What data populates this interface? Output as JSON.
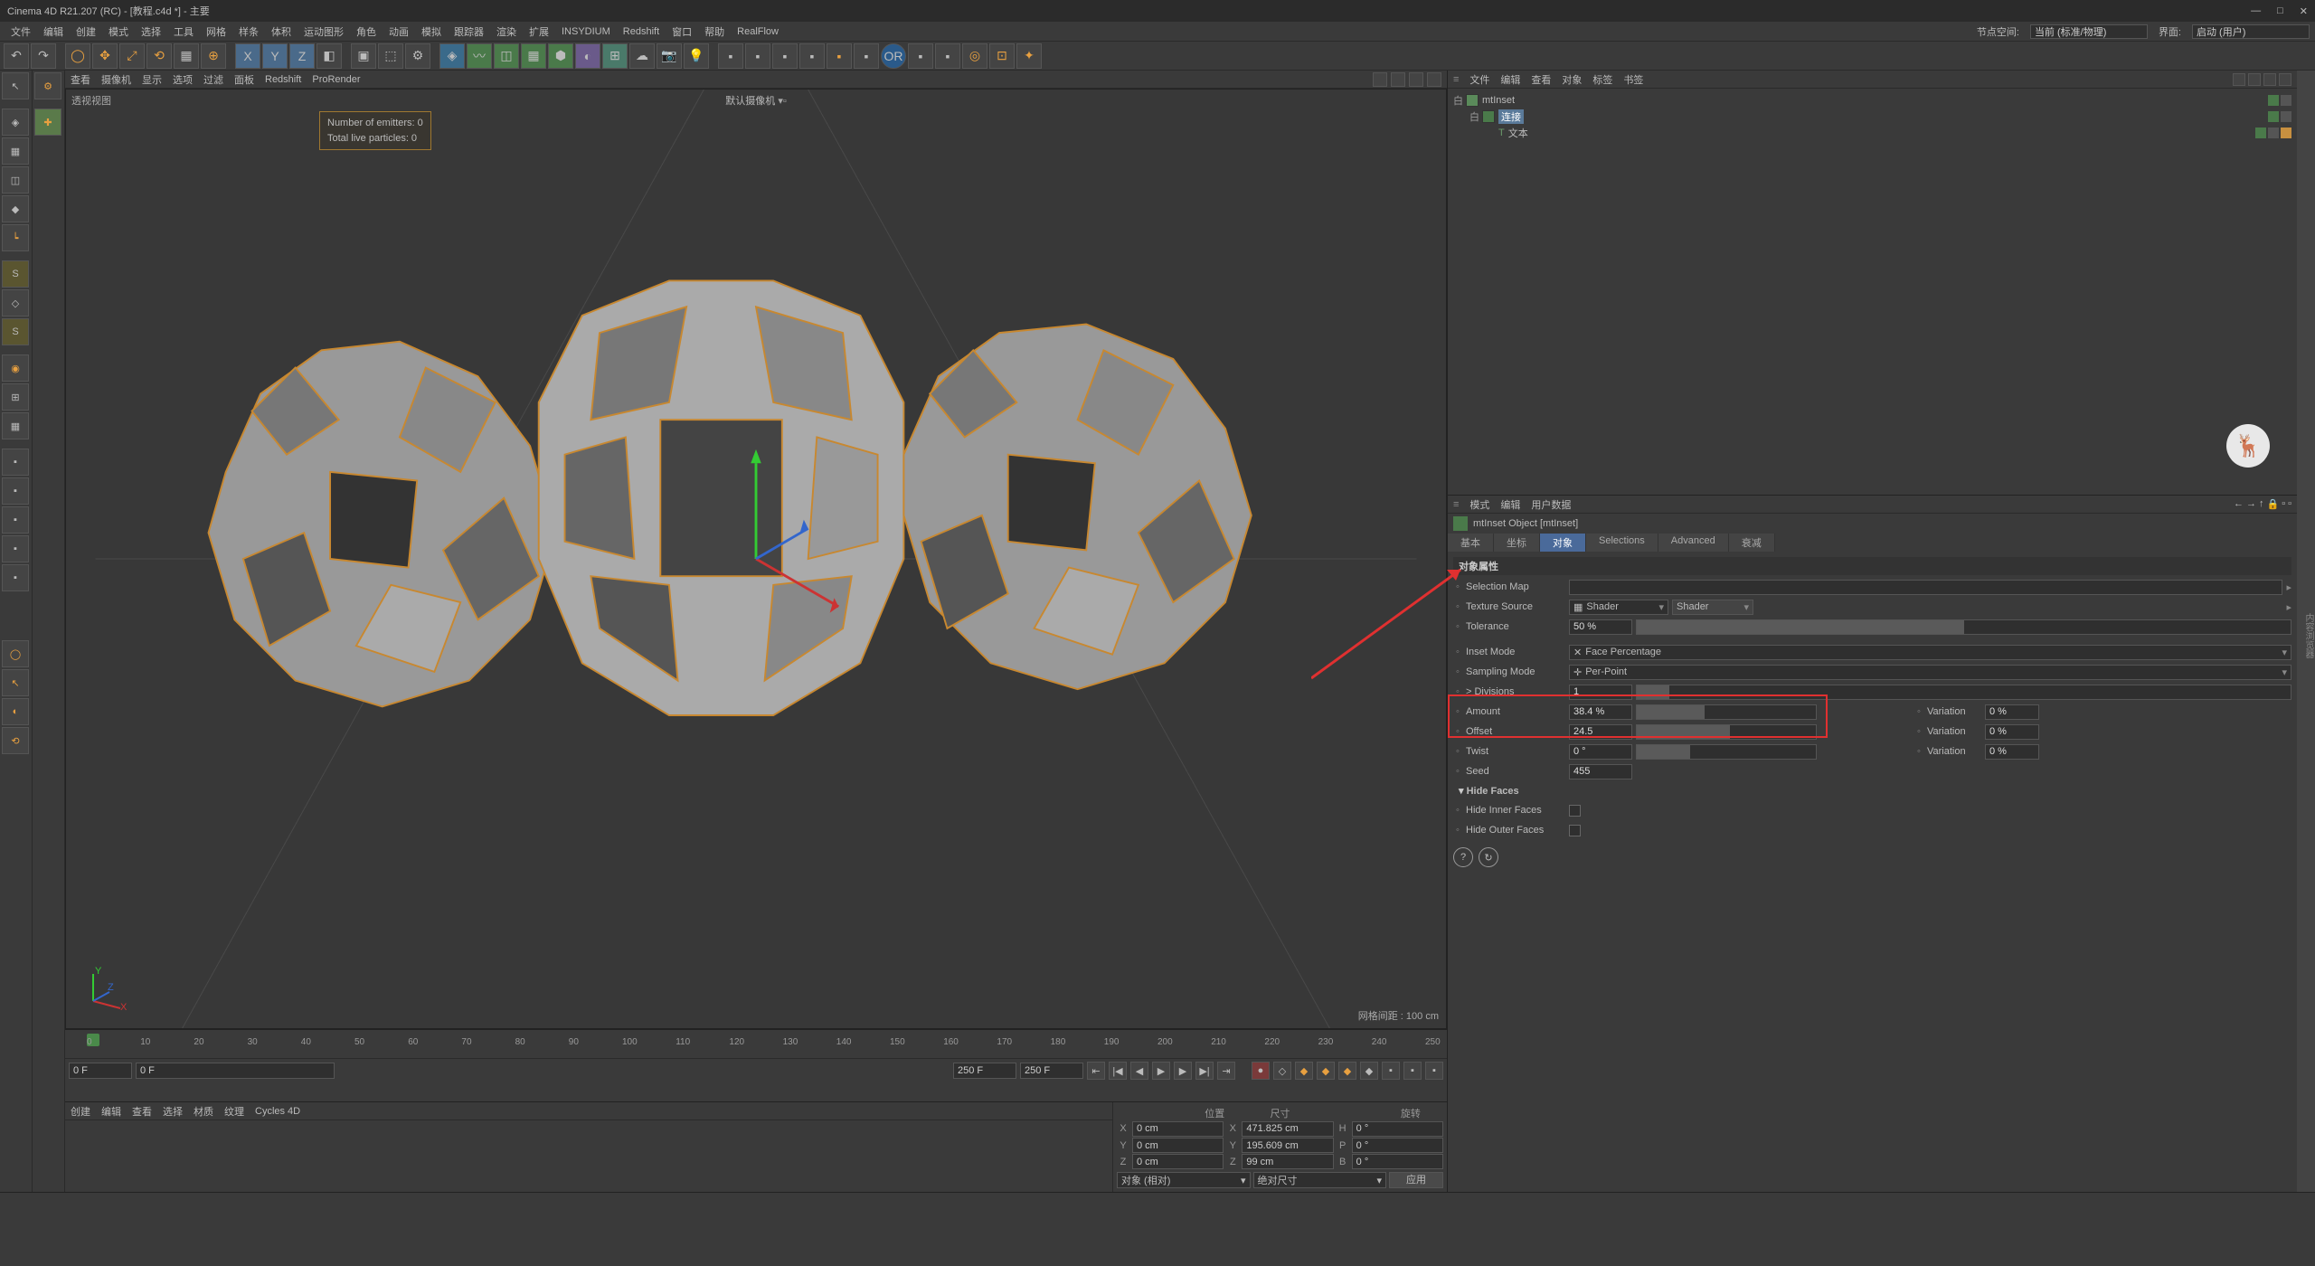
{
  "title": "Cinema 4D R21.207 (RC) - [教程.c4d *] - 主要",
  "menus": [
    "文件",
    "编辑",
    "创建",
    "模式",
    "选择",
    "工具",
    "网格",
    "样条",
    "体积",
    "运动图形",
    "角色",
    "动画",
    "模拟",
    "跟踪器",
    "渲染",
    "扩展",
    "INSYDIUM",
    "Redshift",
    "窗口",
    "帮助",
    "RealFlow"
  ],
  "menuRight": {
    "label": "节点空间:",
    "value1": "当前 (标准/物理)",
    "label2": "界面:",
    "value2": "启动 (用户)"
  },
  "vpMenus": [
    "查看",
    "摄像机",
    "显示",
    "选项",
    "过滤",
    "面板",
    "Redshift",
    "ProRender"
  ],
  "vpLabelTL": "透视视图",
  "vpLabelTC": "默认摄像机",
  "emitters": {
    "l1": "Number of emitters: 0",
    "l2": "Total live particles: 0"
  },
  "gridInfo": "网格间距 : 100 cm",
  "objMenus": [
    "文件",
    "编辑",
    "查看",
    "对象",
    "标签",
    "书签"
  ],
  "tree": [
    {
      "name": "mtInset",
      "indent": 0,
      "sel": false,
      "exp": "白"
    },
    {
      "name": "连接",
      "indent": 1,
      "sel": true,
      "exp": "白"
    },
    {
      "name": "文本",
      "indent": 2,
      "sel": false,
      "exp": ""
    }
  ],
  "attrMenus": [
    "模式",
    "编辑",
    "用户数据"
  ],
  "attrTitle": "mtInset Object [mtInset]",
  "attrTabs": [
    "基本",
    "坐标",
    "对象",
    "Selections",
    "Advanced",
    "衰减"
  ],
  "attrActiveTab": 2,
  "attrSection": "对象属性",
  "attrs": {
    "selMap": {
      "label": "Selection Map"
    },
    "texSrc": {
      "label": "Texture Source",
      "dd": "Shader",
      "btn": "Shader"
    },
    "tol": {
      "label": "Tolerance",
      "val": "50 %",
      "fill": 50
    },
    "insetMode": {
      "label": "Inset Mode",
      "dd": "Face Percentage",
      "ico": "✕"
    },
    "sampMode": {
      "label": "Sampling Mode",
      "dd": "Per-Point",
      "ico": "✛"
    },
    "div": {
      "label": "> Divisions",
      "val": "1",
      "fill": 5
    },
    "amount": {
      "label": "Amount",
      "val": "38.4 %",
      "fill": 38,
      "var": "Variation",
      "varval": "0 %"
    },
    "offset": {
      "label": "Offset",
      "val": "24.5",
      "fill": 52,
      "var": "Variation",
      "varval": "0 %"
    },
    "twist": {
      "label": "Twist",
      "val": "0 °",
      "fill": 30,
      "var": "Variation",
      "varval": "0 %"
    },
    "seed": {
      "label": "Seed",
      "val": "455"
    },
    "hideFaces": {
      "label": "Hide Faces"
    },
    "hideInner": {
      "label": "Hide Inner Faces"
    },
    "hideOuter": {
      "label": "Hide Outer Faces"
    }
  },
  "timeline": {
    "start": "0 F",
    "cur": "0 F",
    "end1": "250 F",
    "end2": "250 F",
    "ticks": [
      0,
      10,
      20,
      30,
      40,
      50,
      60,
      70,
      80,
      90,
      100,
      110,
      120,
      130,
      140,
      150,
      160,
      170,
      180,
      190,
      200,
      210,
      220,
      230,
      240,
      250
    ]
  },
  "bottomMenus": [
    "创建",
    "编辑",
    "查看",
    "选择",
    "材质",
    "纹理",
    "Cycles 4D"
  ],
  "coords": {
    "headers": [
      "位置",
      "尺寸",
      "旋转"
    ],
    "rows": [
      {
        "l": "X",
        "p": "0 cm",
        "s": "471.825 cm",
        "r": "H",
        "rv": "0 °"
      },
      {
        "l": "Y",
        "p": "0 cm",
        "s": "195.609 cm",
        "r": "P",
        "rv": "0 °"
      },
      {
        "l": "Z",
        "p": "0 cm",
        "s": "99 cm",
        "r": "B",
        "rv": "0 °"
      }
    ],
    "dd1": "对象 (相对)",
    "dd2": "绝对尺寸",
    "btn": "应用"
  }
}
